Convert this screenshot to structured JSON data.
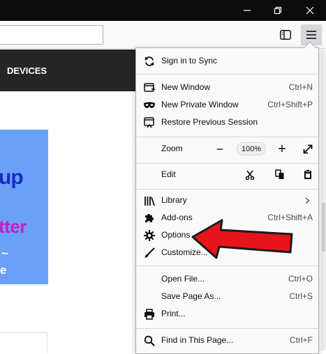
{
  "site": {
    "nav_item": "DEVICES",
    "promo_line1": "up",
    "promo_line2": "tter",
    "promo_line3": "~",
    "promo_line4": "e"
  },
  "menu": {
    "sync": {
      "label": "Sign in to Sync",
      "icon": "sync-icon"
    },
    "new_window": {
      "label": "New Window",
      "shortcut": "Ctrl+N",
      "icon": "new-window-icon"
    },
    "private_window": {
      "label": "New Private Window",
      "shortcut": "Ctrl+Shift+P",
      "icon": "private-mask-icon"
    },
    "restore_session": {
      "label": "Restore Previous Session",
      "icon": "restore-session-icon"
    },
    "zoom": {
      "label": "Zoom",
      "value": "100%",
      "decrease": "−",
      "increase": "+"
    },
    "edit": {
      "label": "Edit"
    },
    "library": {
      "label": "Library",
      "icon": "library-icon"
    },
    "addons": {
      "label": "Add-ons",
      "shortcut": "Ctrl+Shift+A",
      "icon": "puzzle-icon"
    },
    "options": {
      "label": "Options",
      "icon": "gear-icon"
    },
    "customize": {
      "label": "Customize...",
      "icon": "paintbrush-icon"
    },
    "open_file": {
      "label": "Open File...",
      "shortcut": "Ctrl+O"
    },
    "save_page": {
      "label": "Save Page As...",
      "shortcut": "Ctrl+S"
    },
    "print": {
      "label": "Print...",
      "icon": "printer-icon"
    },
    "find": {
      "label": "Find in This Page...",
      "shortcut": "Ctrl+F",
      "icon": "search-icon"
    }
  },
  "colors": {
    "titlebar": "#0c0c0d",
    "menu_bg": "#f9f9fa",
    "annotation_arrow": "#e8141c"
  }
}
